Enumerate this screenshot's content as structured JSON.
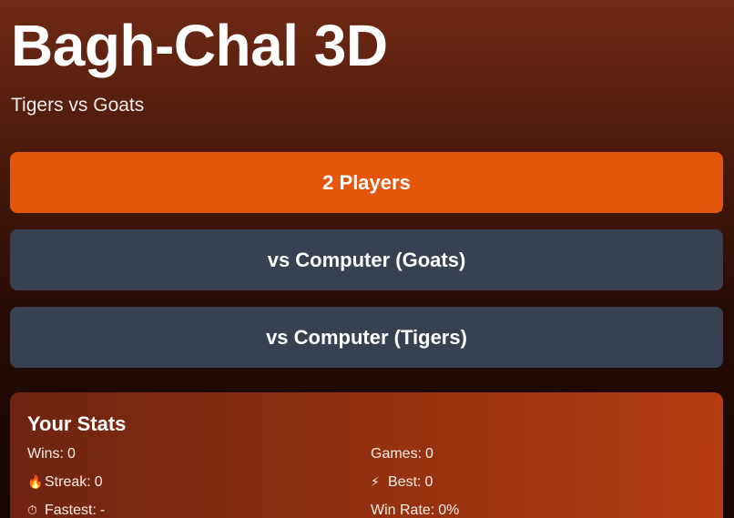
{
  "header": {
    "title": "Bagh-Chal 3D",
    "subtitle": "Tigers vs Goats"
  },
  "modes": {
    "two_players": "2 Players",
    "vs_computer_goats": "vs Computer (Goats)",
    "vs_computer_tigers": "vs Computer (Tigers)"
  },
  "stats": {
    "title": "Your Stats",
    "wins_label": "Wins:",
    "wins_value": "0",
    "games_label": "Games:",
    "games_value": "0",
    "streak_icon": "🔥",
    "streak_label": "Streak:",
    "streak_value": "0",
    "best_icon": "⚡",
    "best_label": "Best:",
    "best_value": "0",
    "fastest_icon": "⏱",
    "fastest_label": "Fastest:",
    "fastest_value": "-",
    "winrate_label": "Win Rate:",
    "winrate_value": "0%"
  },
  "colors": {
    "primary_button": "#e4560b",
    "secondary_button": "#374151",
    "stats_card_accent": "#b53d0f"
  }
}
